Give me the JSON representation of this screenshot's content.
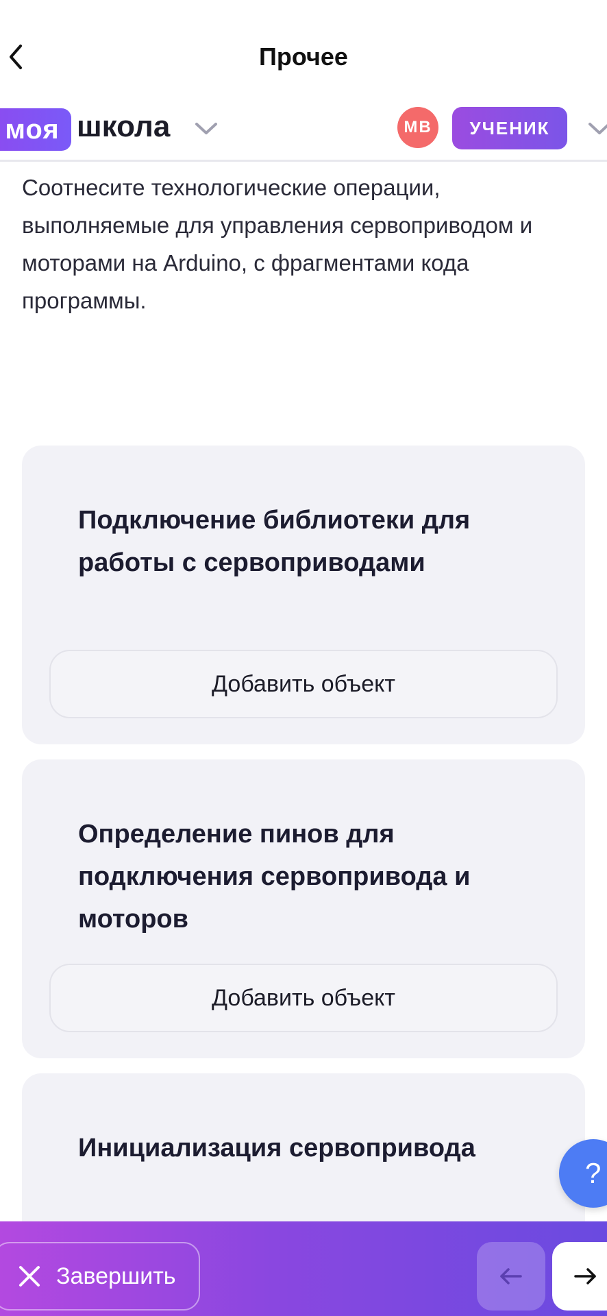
{
  "nav": {
    "title": "Прочее"
  },
  "header": {
    "logo_part1": "моя",
    "logo_part2": "школа",
    "avatar_initials": "МВ",
    "role": "УЧЕНИК"
  },
  "question": {
    "text": "Соотнесите технологические операции, выполняемые для управления сервоприводом и моторами на Arduino, с фрагментами кода программы."
  },
  "cards": [
    {
      "title": "Подключение библиотеки для работы с сервоприводами",
      "button": "Добавить объект"
    },
    {
      "title": "Определение пинов для подключения сервопривода и моторов",
      "button": "Добавить объект"
    },
    {
      "title": "Инициализация сервопривода"
    }
  ],
  "help": {
    "label": "?"
  },
  "footer": {
    "finish_label": "Завершить"
  },
  "colors": {
    "accent": "#7a5af8",
    "avatar": "#f46a6a",
    "help": "#4d7cf4",
    "card_bg": "#f2f2f7"
  }
}
